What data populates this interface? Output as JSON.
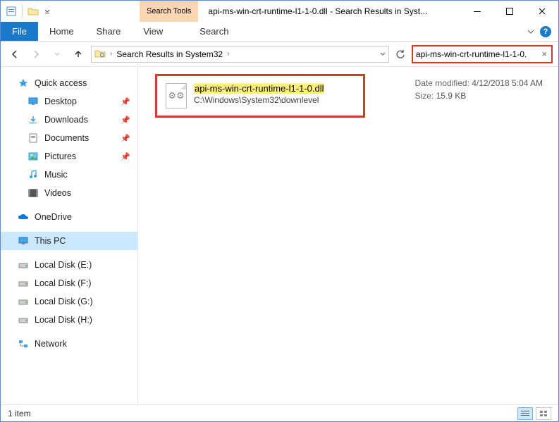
{
  "window": {
    "title": "api-ms-win-crt-runtime-l1-1-0.dll - Search Results in Syst...",
    "search_tools_label": "Search Tools"
  },
  "ribbon": {
    "file": "File",
    "tabs": [
      "Home",
      "Share",
      "View"
    ],
    "search_tab": "Search"
  },
  "navbar": {
    "path_label": "Search Results in System32",
    "search_value": "api-ms-win-crt-runtime-l1-1-0."
  },
  "sidebar": {
    "quick_access": "Quick access",
    "quick_items": [
      {
        "label": "Desktop",
        "pinned": true
      },
      {
        "label": "Downloads",
        "pinned": true
      },
      {
        "label": "Documents",
        "pinned": true
      },
      {
        "label": "Pictures",
        "pinned": true
      },
      {
        "label": "Music",
        "pinned": false
      },
      {
        "label": "Videos",
        "pinned": false
      }
    ],
    "onedrive": "OneDrive",
    "this_pc": "This PC",
    "drives": [
      {
        "label": "Local Disk (E:)"
      },
      {
        "label": "Local Disk (F:)"
      },
      {
        "label": "Local Disk (G:)"
      },
      {
        "label": "Local Disk (H:)"
      }
    ],
    "network": "Network"
  },
  "result": {
    "filename": "api-ms-win-crt-runtime-l1-1-0.dll",
    "path": "C:\\Windows\\System32\\downlevel",
    "date_modified_label": "Date modified:",
    "date_modified": "4/12/2018 5:04 AM",
    "size_label": "Size:",
    "size": "15.9 KB"
  },
  "status": {
    "count": "1 item"
  }
}
